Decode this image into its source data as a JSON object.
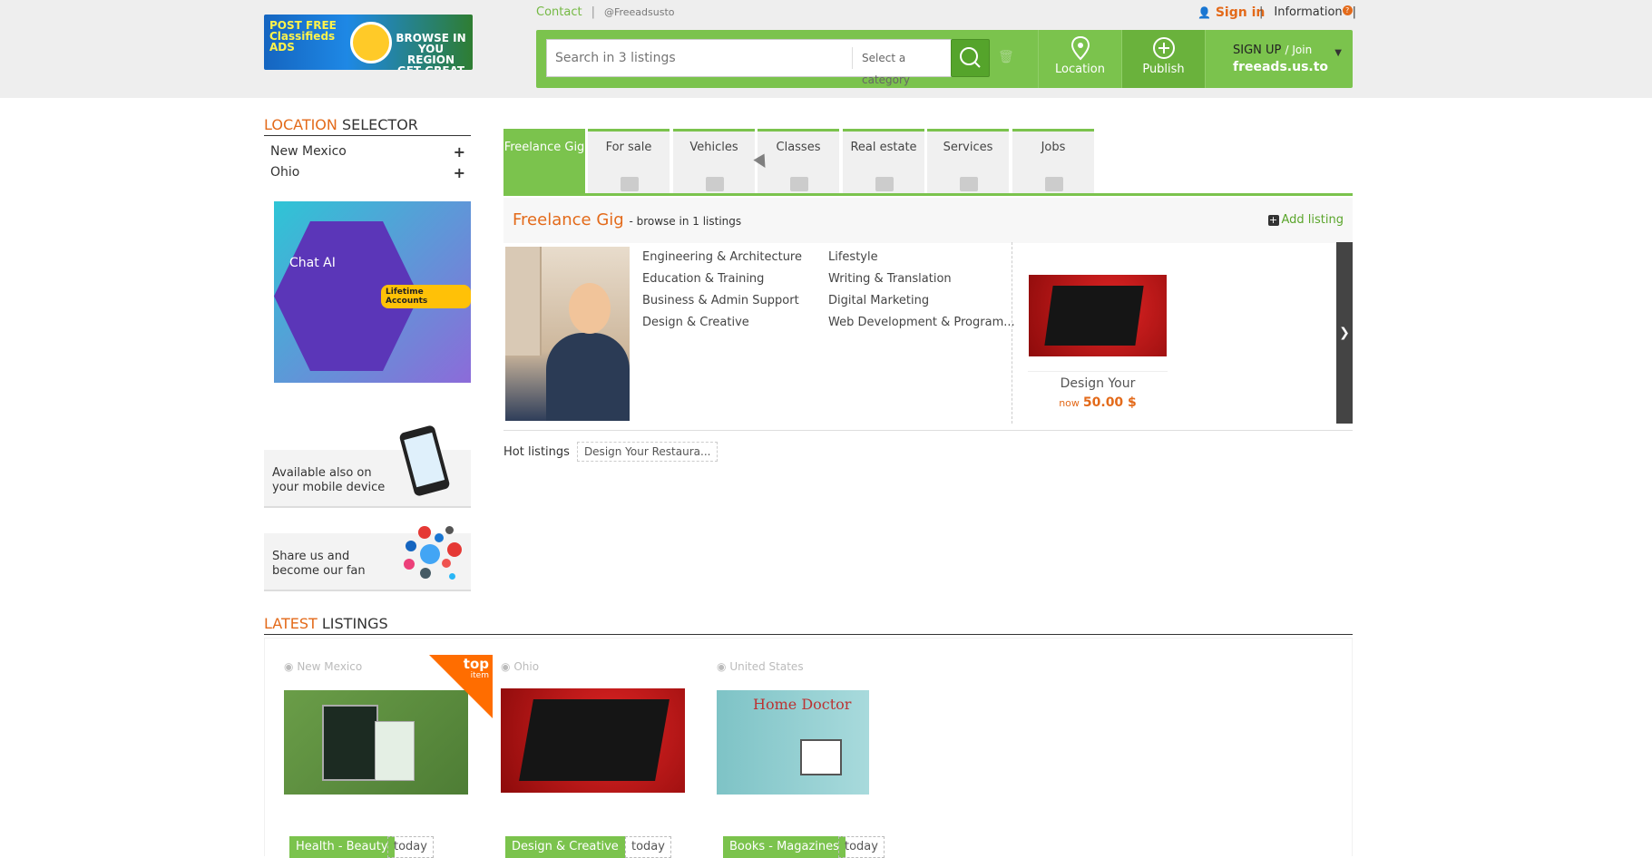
{
  "header": {
    "logo_left": "POST FREE Classifieds ADS",
    "logo_right": "BROWSE IN YOU REGION GET GREAT DEALS",
    "contact": "Contact",
    "handle": "@Freeadsusto",
    "signin": "Sign in",
    "information": "Information",
    "info_badge": "?"
  },
  "search": {
    "placeholder": "Search in 3 listings",
    "category": "Select a category"
  },
  "nav": {
    "location": "Location",
    "publish": "Publish",
    "signup": "SIGN UP",
    "join": "/ Join",
    "site": "freeads.us.to"
  },
  "location_selector": {
    "title_accent": "LOCATION",
    "title_rest": "SELECTOR",
    "items": [
      {
        "label": "New Mexico"
      },
      {
        "label": "Ohio"
      }
    ]
  },
  "ad": {
    "chat": "Chat AI",
    "lifetime": "Lifetime Accounts"
  },
  "promos": {
    "mobile": "Available also on your mobile device",
    "share": "Share us and become our fan"
  },
  "tabs": [
    {
      "label": "Freelance Gig",
      "active": true
    },
    {
      "label": "For sale"
    },
    {
      "label": "Vehicles"
    },
    {
      "label": "Classes"
    },
    {
      "label": "Real estate"
    },
    {
      "label": "Services"
    },
    {
      "label": "Jobs"
    }
  ],
  "section": {
    "title": "Freelance Gig",
    "subtitle": "- browse in 1 listings",
    "add_listing": "Add listing"
  },
  "categories_col1": [
    "Engineering & Architecture",
    "Education & Training",
    "Business & Admin Support",
    "Design & Creative"
  ],
  "categories_col2": [
    "Lifestyle",
    "Writing & Translation",
    "Digital Marketing",
    "Web Development & Program..."
  ],
  "featured": {
    "title": "Design Your",
    "now": "now",
    "price": "50.00 $"
  },
  "hot": {
    "label": "Hot listings",
    "item": "Design Your Restaura..."
  },
  "latest": {
    "title_accent": "LATEST",
    "title_rest": "LISTINGS",
    "cards": [
      {
        "location": "New Mexico",
        "category": "Health - Beauty",
        "date": "today",
        "ribbon": "top",
        "ribbon_sub": "item"
      },
      {
        "location": "Ohio",
        "category": "Design & Creative",
        "date": "today"
      },
      {
        "location": "United States",
        "category": "Books - Magazines",
        "date": "today",
        "image_text": "Home Doctor"
      }
    ]
  },
  "colors": {
    "brand_green": "#7bc34d",
    "accent_orange": "#e36a1a"
  }
}
